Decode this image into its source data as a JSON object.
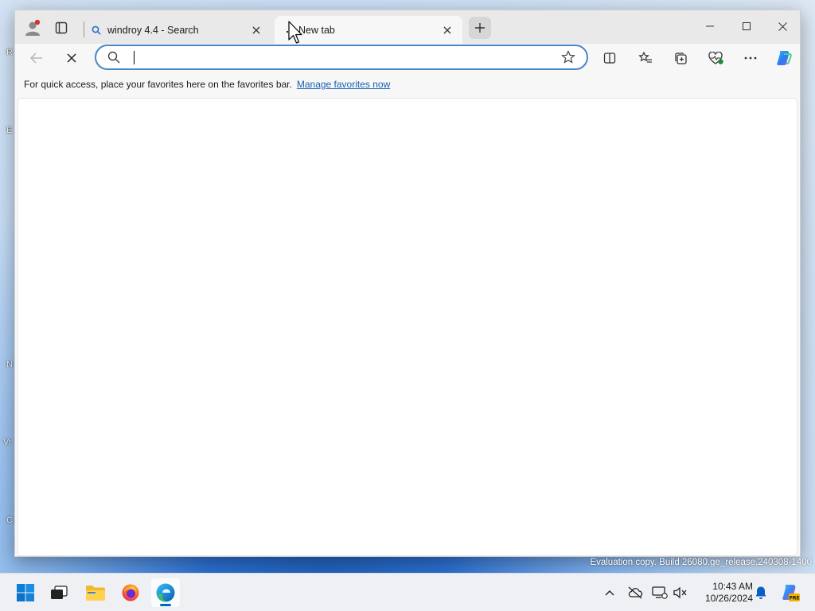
{
  "browser": {
    "tabs": [
      {
        "title": "windroy 4.4 - Search",
        "active": false
      },
      {
        "title": "New tab",
        "active": true
      }
    ],
    "address_bar": {
      "value": "",
      "placeholder": ""
    },
    "favorites_bar": {
      "message": "For quick access, place your favorites here on the favorites bar.",
      "link": "Manage favorites now"
    }
  },
  "desktop": {
    "watermark": "Evaluation copy. Build 26080.ge_release.240308-1400",
    "edge_glyphs": [
      "R",
      "E",
      "N",
      "Vi",
      "C"
    ]
  },
  "taskbar": {
    "apps": [
      {
        "name": "start",
        "icon": "windows-start-icon"
      },
      {
        "name": "task-view",
        "icon": "task-view-icon"
      },
      {
        "name": "file-explorer",
        "icon": "folder-icon"
      },
      {
        "name": "firefox",
        "icon": "firefox-icon"
      },
      {
        "name": "edge",
        "icon": "edge-icon",
        "active": true
      }
    ],
    "time": "10:43 AM",
    "date": "10/26/2024"
  },
  "colors": {
    "accent": "#0067c0",
    "address_focus": "#4a86c8",
    "link": "#1a5fb4"
  }
}
